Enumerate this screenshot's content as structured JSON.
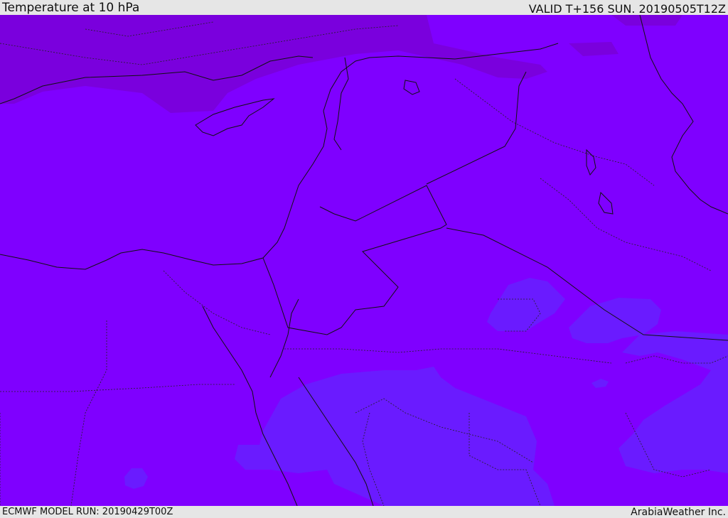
{
  "header": {
    "title": "Temperature at 10 hPa",
    "valid_time": "VALID T+156 SUN. 20190505T12Z"
  },
  "footer": {
    "model_run": "ECMWF MODEL RUN: 20190429T00Z",
    "credit": "ArabiaWeather Inc."
  },
  "map": {
    "variable": "temperature",
    "level": "10 hPa",
    "colors": {
      "base_field": "#7f00ff",
      "warm_band_north": "#7a00dd",
      "cool_patches": "#6a1bff",
      "coastlines": "#111111",
      "borders": "#222222"
    }
  }
}
